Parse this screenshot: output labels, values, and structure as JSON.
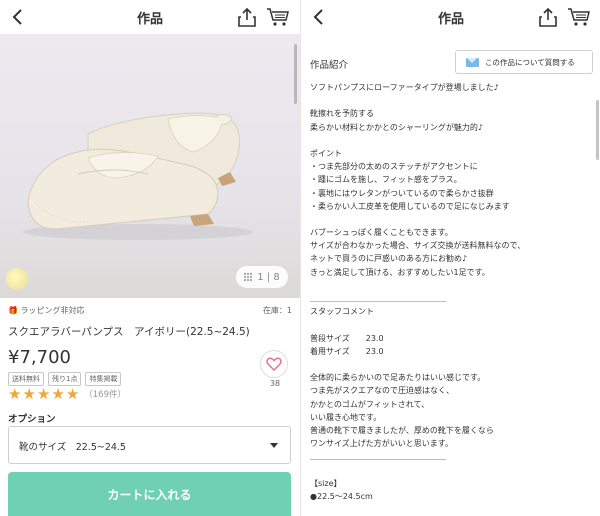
{
  "left": {
    "nav": {
      "title": "作品",
      "back_icon": "chevron-left-icon",
      "share_icon": "share-icon",
      "cart_icon": "cart-icon"
    },
    "photo": {
      "counter": "1 | 8"
    },
    "wrapping": "ラッピング非対応",
    "stock": "在庫：1",
    "product_name": "スクエアラバーパンプス　アイボリー(22.5~24.5)",
    "price": "¥7,700",
    "tags": [
      "送料無料",
      "残り1点",
      "特集掲載"
    ],
    "rating": {
      "stars": 5,
      "count": "（169件）"
    },
    "favorite": {
      "count": "38"
    },
    "option_label": "オプション",
    "option_value": "靴のサイズ　22.5~24.5",
    "cart_button": "カートに入れる"
  },
  "right": {
    "nav": {
      "title": "作品"
    },
    "section_title": "作品紹介",
    "ask_button": "この作品について質問する",
    "description": [
      "ソフトパンプスにローファータイプが登場しました♪",
      "",
      "靴擦れを予防する",
      "柔らかい材料とかかとのシャーリングが魅力的♪",
      "",
      "ポイント",
      "・つま先部分の太めのステッチがアクセントに",
      "・踵にゴムを施し、フィット感をプラス。",
      "・裏地にはウレタンがついているので柔らかさ抜群",
      "・柔らかい人工皮革を使用しているので足になじみます",
      "",
      "バブーシュっぽく履くこともできます。",
      "サイズが合わなかった場合、サイズ交換が送料無料なので、",
      "ネットで買うのに戸惑いのある方にお勧め♪",
      "きっと満足して頂ける、おすすめしたい1足です。",
      "",
      "＿＿＿＿＿＿＿＿＿＿＿＿＿＿＿＿＿",
      "スタッフコメント",
      "",
      "普段サイズ　　23.0",
      "着用サイズ　　23.0",
      "",
      "全体的に柔らかいので足あたりはいい感じです。",
      "つま先がスクエアなので圧迫感はなく、",
      "かかとのゴムがフィットされて、",
      "いい履き心地です。",
      "普通の靴下で履きましたが、厚めの靴下を履くなら",
      "ワンサイズ上げた方がいいと思います。",
      "＿＿＿＿＿＿＿＿＿＿＿＿＿＿＿＿＿",
      "",
      "【size】",
      "●22.5～24.5cm"
    ]
  },
  "colors": {
    "accent": "#6fd0b2",
    "star": "#f2a53a",
    "favorite": "#e86a8e",
    "mail": "#7ab8e6"
  }
}
